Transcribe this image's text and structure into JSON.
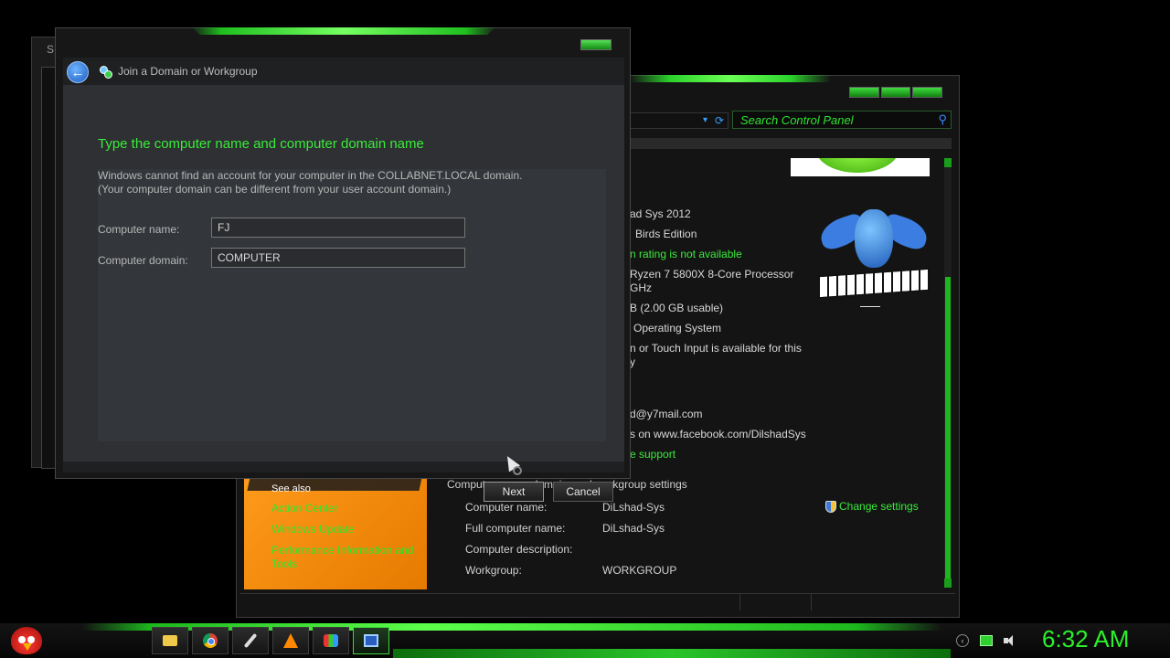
{
  "back_window": {
    "title_fragment": "S"
  },
  "control_panel": {
    "search": {
      "placeholder": "Search Control Panel"
    },
    "system": {
      "lines": [
        "ad Sys 2012",
        "Birds Edition",
        "n rating is not available",
        "Ryzen 7 5800X 8-Core Processor",
        "GHz",
        "B (2.00 GB usable)",
        "Operating System",
        "n or Touch Input is available for this",
        "y",
        "d@y7mail.com",
        "s on www.facebook.com/DilshadSys",
        "e support"
      ]
    },
    "see_also": {
      "heading": "See also",
      "links": [
        "Action Center",
        "Windows Update",
        "Performance Information and",
        "Tools"
      ]
    },
    "computer_settings": {
      "section_title": "Computer name, domain, and workgroup settings",
      "rows": [
        {
          "label": "Computer name:",
          "value": "DiLshad-Sys"
        },
        {
          "label": "Full computer name:",
          "value": "DiLshad-Sys"
        },
        {
          "label": "Computer description:",
          "value": ""
        },
        {
          "label": "Workgroup:",
          "value": "WORKGROUP"
        }
      ],
      "change_link": "Change settings"
    }
  },
  "dialog": {
    "title": "Join a Domain or Workgroup",
    "heading": "Type the computer name and computer domain name",
    "message_line1": "Windows cannot find an account for your computer in the COLLABNET.LOCAL domain.",
    "message_line2": "(Your computer domain can be different from your user account domain.)",
    "computer_name_label": "Computer name:",
    "computer_name_value": "FJ",
    "computer_domain_label": "Computer domain:",
    "computer_domain_value": "COMPUTER",
    "next_label": "Next",
    "cancel_label": "Cancel"
  },
  "taskbar": {
    "items": [
      "folder-icon",
      "chrome-icon",
      "rocket-icon",
      "vlc-icon",
      "paint-icon",
      "system-properties-icon"
    ],
    "clock": "6:32 AM"
  },
  "colors": {
    "accent": "#39ec39",
    "link_blue": "#3a8cff",
    "orange_panel": "#ff9a1a"
  }
}
